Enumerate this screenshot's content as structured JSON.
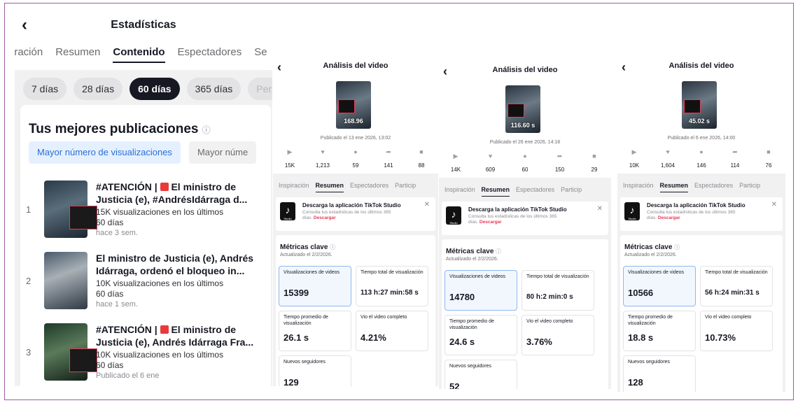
{
  "left": {
    "title": "Estadísticas",
    "tabs": [
      "iración",
      "Resumen",
      "Contenido",
      "Espectadores",
      "Se"
    ],
    "active_tab": "Contenido",
    "chips": [
      "7 días",
      "28 días",
      "60 días",
      "365 días",
      "Perso"
    ],
    "active_chip": "60 días",
    "section_title": "Tus mejores publicaciones",
    "subtabs": [
      "Mayor número de visualizaciones",
      "Mayor núme"
    ],
    "posts": [
      {
        "n": "1",
        "title": "#ATENCIÓN | ",
        "title2": "El ministro de Justicia (e), #AndrésIdárraga d...",
        "views": "15K visualizaciones en los últimos",
        "period": "60 días",
        "age": "hace 3 sem."
      },
      {
        "n": "2",
        "title": "",
        "title2": "El ministro de Justicia (e), Andrés Idárraga, ordenó el bloqueo in...",
        "views": "10K visualizaciones en los últimos",
        "period": "60 días",
        "age": "hace 1 sem."
      },
      {
        "n": "3",
        "title": "#ATENCIÓN | ",
        "title2": "El ministro de Justicia (e), Andrés Idárraga Fra...",
        "views": "10K visualizaciones en los últimos",
        "period": "60 días",
        "age": "Publicado el 6 ene"
      }
    ]
  },
  "videos": [
    {
      "title": "Análisis del video",
      "duration": "168.96",
      "published": "Publicado el 13 ene 2026, 13:02",
      "stats": [
        "15K",
        "1,213",
        "59",
        "141",
        "88"
      ],
      "tabs": [
        "Inspiración",
        "Resumen",
        "Espectadores",
        "Particip"
      ],
      "promo_title": "Descarga la aplicación TikTok Studio",
      "promo_desc": "Consulta tus estadísticas de los últimos 365 días.",
      "promo_link": "Descargar",
      "metrics_title": "Métricas clave",
      "updated": "Actualizado el 2/2/2026.",
      "m": [
        {
          "l": "Visualizaciones de videos",
          "v": "15399"
        },
        {
          "l": "Tiempo total de visualización",
          "v": "113 h:27 min:58 s"
        },
        {
          "l": "Tiempo promedio de visualización",
          "v": "26.1 s"
        },
        {
          "l": "Vio el video completo",
          "v": "4.21%"
        },
        {
          "l": "Nuevos seguidores",
          "v": "129"
        }
      ]
    },
    {
      "title": "Análisis del video",
      "duration": "116.60 s",
      "published": "Publicado el 26 ene 2026, 14:18",
      "stats": [
        "14K",
        "609",
        "60",
        "150",
        "29"
      ],
      "tabs": [
        "Inspiración",
        "Resumen",
        "Espectadores",
        "Particip"
      ],
      "promo_title": "Descarga la aplicación TikTok Studio",
      "promo_desc": "Consulta tus estadísticas de los últimos 365 días.",
      "promo_link": "Descargar",
      "metrics_title": "Métricas clave",
      "updated": "Actualizado el 2/2/2026.",
      "m": [
        {
          "l": "Visualizaciones de videos",
          "v": "14780"
        },
        {
          "l": "Tiempo total de visualización",
          "v": "80 h:2 min:0 s"
        },
        {
          "l": "Tiempo promedio de visualización",
          "v": "24.6 s"
        },
        {
          "l": "Vio el video completo",
          "v": "3.76%"
        },
        {
          "l": "Nuevos seguidores",
          "v": "52"
        }
      ]
    },
    {
      "title": "Análisis del video",
      "duration": "45.02 s",
      "published": "Publicado el 6 ene 2026, 14:00",
      "stats": [
        "10K",
        "1,604",
        "146",
        "114",
        "76"
      ],
      "tabs": [
        "Inspiración",
        "Resumen",
        "Espectadores",
        "Particip"
      ],
      "promo_title": "Descarga la aplicación TikTok Studio",
      "promo_desc": "Consulta tus estadísticas de los últimos 365 días.",
      "promo_link": "Descargar",
      "metrics_title": "Métricas clave",
      "updated": "Actualizado el 2/2/2026.",
      "m": [
        {
          "l": "Visualizaciones de videos",
          "v": "10566"
        },
        {
          "l": "Tiempo total de visualización",
          "v": "56 h:24 min:31 s"
        },
        {
          "l": "Tiempo promedio de visualización",
          "v": "18.8 s"
        },
        {
          "l": "Vio el video completo",
          "v": "10.73%"
        },
        {
          "l": "Nuevos seguidores",
          "v": "128"
        }
      ]
    }
  ]
}
